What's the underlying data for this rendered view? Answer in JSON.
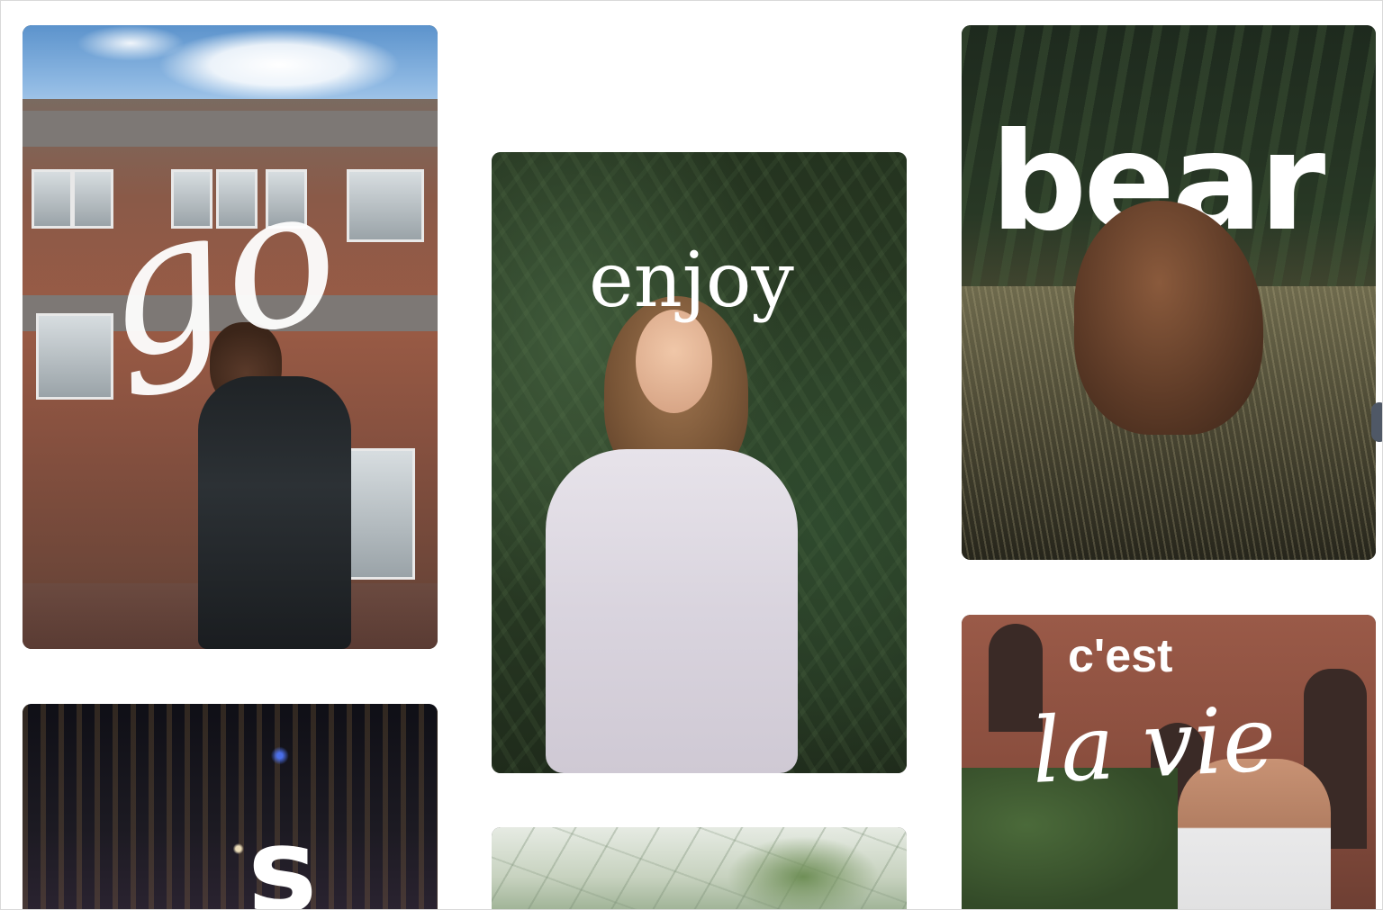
{
  "gallery": {
    "cards": [
      {
        "overlay_text": "go",
        "subject": "man-street-photo"
      },
      {
        "overlay_text": "enjoy",
        "subject": "woman-foliage-photo"
      },
      {
        "overlay_text": "bear",
        "subject": "bear-photo"
      },
      {
        "overlay_text_top": "c'est",
        "overlay_text_bottom": "la vie",
        "subject": "man-smoking-photo"
      },
      {
        "overlay_text": "s",
        "subject": "night-city-photo"
      },
      {
        "overlay_text": "",
        "subject": "greenhouse-photo"
      }
    ]
  },
  "colors": {
    "background": "#ffffff",
    "overlay_text": "#ffffff",
    "edge_handle": "#4f5866"
  }
}
